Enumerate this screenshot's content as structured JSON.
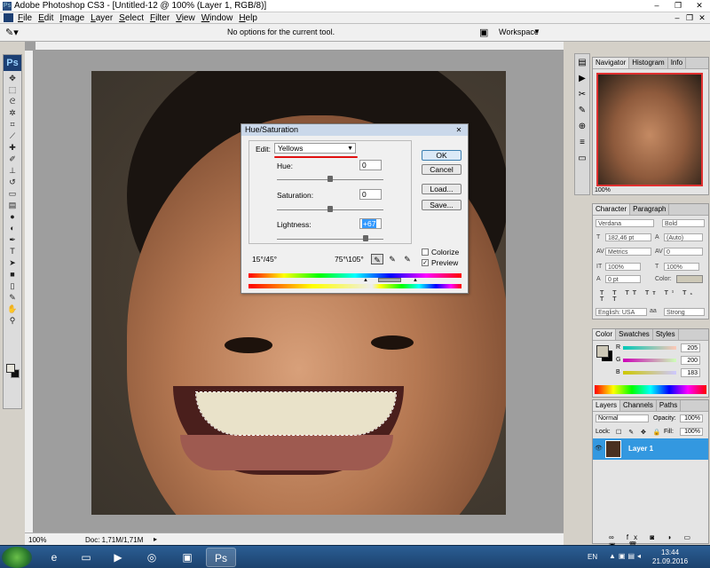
{
  "window": {
    "title": "Adobe Photoshop CS3 - [Untitled-12 @ 100% (Layer 1, RGB/8)]",
    "controls": [
      "–",
      "❐",
      "✕"
    ]
  },
  "menubar": {
    "items": [
      "File",
      "Edit",
      "Image",
      "Layer",
      "Select",
      "Filter",
      "View",
      "Window",
      "Help"
    ],
    "doc_controls": [
      "–",
      "❐",
      "✕"
    ]
  },
  "optionsbar": {
    "message": "No options for the current tool.",
    "workspace_label": "Workspace"
  },
  "toolbox": {
    "logo": "Ps",
    "tools": [
      "move-icon",
      "marquee-icon",
      "lasso-icon",
      "magic-wand-icon",
      "crop-icon",
      "slice-icon",
      "healing-icon",
      "brush-icon",
      "stamp-icon",
      "history-brush-icon",
      "eraser-icon",
      "gradient-icon",
      "blur-icon",
      "dodge-icon",
      "pen-icon",
      "type-icon",
      "path-select-icon",
      "shape-icon",
      "notes-icon",
      "eyedropper-icon",
      "hand-icon",
      "zoom-icon"
    ],
    "fg_color": "#e8e6dc",
    "bg_color": "#111111"
  },
  "status": {
    "zoom": "100%",
    "doc_size": "Doc: 1,71M/1,71M"
  },
  "dialog": {
    "title": "Hue/Saturation",
    "edit_label": "Edit:",
    "edit_value": "Yellows",
    "hue_label": "Hue:",
    "hue_value": "0",
    "saturation_label": "Saturation:",
    "saturation_value": "0",
    "lightness_label": "Lightness:",
    "lightness_value": "+67",
    "buttons": {
      "ok": "OK",
      "cancel": "Cancel",
      "load": "Load...",
      "save": "Save..."
    },
    "colorize_label": "Colorize",
    "colorize_checked": false,
    "preview_label": "Preview",
    "preview_checked": true,
    "range_left": "15°/45°",
    "range_right": "75°\\105°",
    "hue_level": 0,
    "saturation_level": 0,
    "lightness_level": 67,
    "highlight_color": "#e01010"
  },
  "navigator": {
    "tabs": [
      "Navigator",
      "Histogram",
      "Info"
    ],
    "zoom": "100%"
  },
  "character": {
    "tabs": [
      "Character",
      "Paragraph"
    ],
    "font_family": "Verdana",
    "font_style": "Bold",
    "font_size": "182,46 pt",
    "leading": "(Auto)",
    "kerning": "Metrics",
    "tracking": "0",
    "vertical_scale": "100%",
    "horizontal_scale": "100%",
    "baseline": "0 pt",
    "color_label": "Color:",
    "language": "English: USA",
    "antialias": "Strong"
  },
  "color": {
    "tabs": [
      "Color",
      "Swatches",
      "Styles"
    ],
    "channels": [
      {
        "label": "R",
        "value": "205"
      },
      {
        "label": "G",
        "value": "200"
      },
      {
        "label": "B",
        "value": "183"
      }
    ],
    "fg_color": "#cdc8b7"
  },
  "layers": {
    "tabs": [
      "Layers",
      "Channels",
      "Paths"
    ],
    "blend_mode": "Normal",
    "opacity_label": "Opacity:",
    "opacity": "100%",
    "lock_label": "Lock:",
    "fill_label": "Fill:",
    "fill": "100%",
    "layer_name": "Layer 1",
    "selection_color": "#3398e0"
  },
  "taskbar": {
    "items": [
      "ie-icon",
      "folder-icon",
      "media-icon",
      "chrome-icon",
      "app-icon",
      "photoshop-icon"
    ],
    "photoshop_label": "Ps",
    "language": "EN",
    "time": "13:44",
    "date": "21.09.2016"
  }
}
